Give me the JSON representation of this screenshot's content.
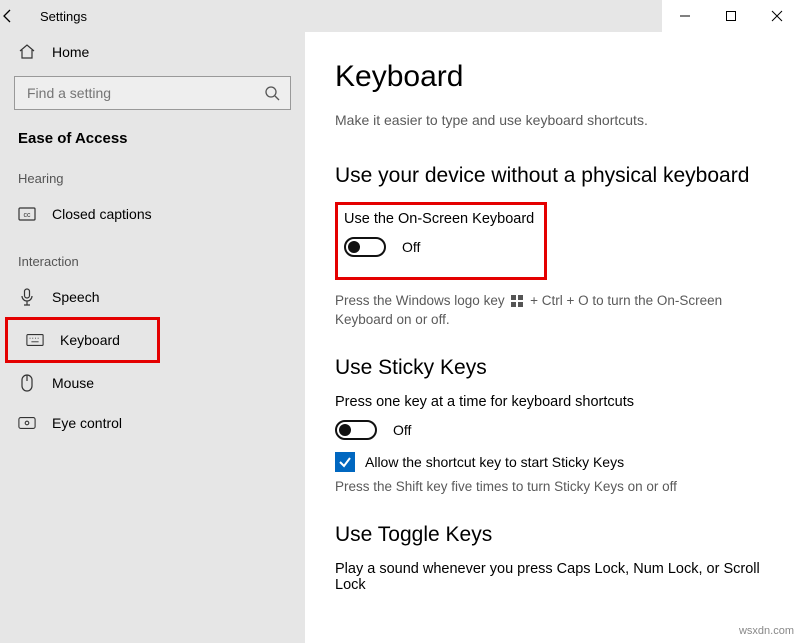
{
  "titlebar": {
    "title": "Settings"
  },
  "sidebar": {
    "home": "Home",
    "search_placeholder": "Find a setting",
    "category": "Ease of Access",
    "groups": {
      "hearing": {
        "label": "Hearing",
        "closed_captions": "Closed captions"
      },
      "interaction": {
        "label": "Interaction",
        "speech": "Speech",
        "keyboard": "Keyboard",
        "mouse": "Mouse",
        "eye_control": "Eye control"
      }
    }
  },
  "main": {
    "title": "Keyboard",
    "subtitle": "Make it easier to type and use keyboard shortcuts.",
    "sections": {
      "no_physical": {
        "heading": "Use your device without a physical keyboard",
        "use_osk_label": "Use the On-Screen Keyboard",
        "osk_state": "Off",
        "osk_hint_pre": "Press the Windows logo key",
        "osk_hint_post": " + Ctrl + O to turn the On-Screen Keyboard on or off."
      },
      "sticky": {
        "heading": "Use Sticky Keys",
        "desc": "Press one key at a time for keyboard shortcuts",
        "state": "Off",
        "allow_label": "Allow the shortcut key to start Sticky Keys",
        "allow_hint": "Press the Shift key five times to turn Sticky Keys on or off"
      },
      "toggle": {
        "heading": "Use Toggle Keys",
        "desc": "Play a sound whenever you press Caps Lock, Num Lock, or Scroll Lock"
      }
    }
  },
  "watermark": "wsxdn.com"
}
